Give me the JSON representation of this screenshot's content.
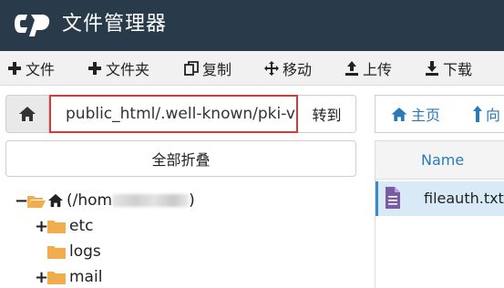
{
  "header": {
    "title": "文件管理器",
    "logo_icon": "cpanel-logo",
    "bg": "#293a4a"
  },
  "toolbar": {
    "items": [
      {
        "label": "文件",
        "icon": "plus-icon"
      },
      {
        "label": "文件夹",
        "icon": "plus-icon"
      },
      {
        "label": "复制",
        "icon": "copy-icon"
      },
      {
        "label": "移动",
        "icon": "move-arrows-icon"
      },
      {
        "label": "上传",
        "icon": "upload-icon"
      },
      {
        "label": "下载",
        "icon": "download-icon"
      }
    ]
  },
  "path_bar": {
    "value": "public_html/.well-known/pki-v",
    "go_label": "转到",
    "highlight_color": "#d33a3a"
  },
  "collapse_all_label": "全部折叠",
  "tree": {
    "root": {
      "prefix": "(/hom",
      "suffix": ")",
      "toggle": "−"
    },
    "children": [
      {
        "name": "etc",
        "toggle": "+"
      },
      {
        "name": "logs",
        "toggle": ""
      },
      {
        "name": "mail",
        "toggle": "+"
      }
    ]
  },
  "right_pane": {
    "home_label": "主页",
    "up_label": "向",
    "column_name": "Name",
    "files": [
      {
        "name": "fileauth.txt",
        "icon": "text-file-icon",
        "selected": true
      }
    ]
  },
  "colors": {
    "accent": "#2a7ab8",
    "folder": "#f0ad4e",
    "selected_row": "#d9eaf7"
  }
}
